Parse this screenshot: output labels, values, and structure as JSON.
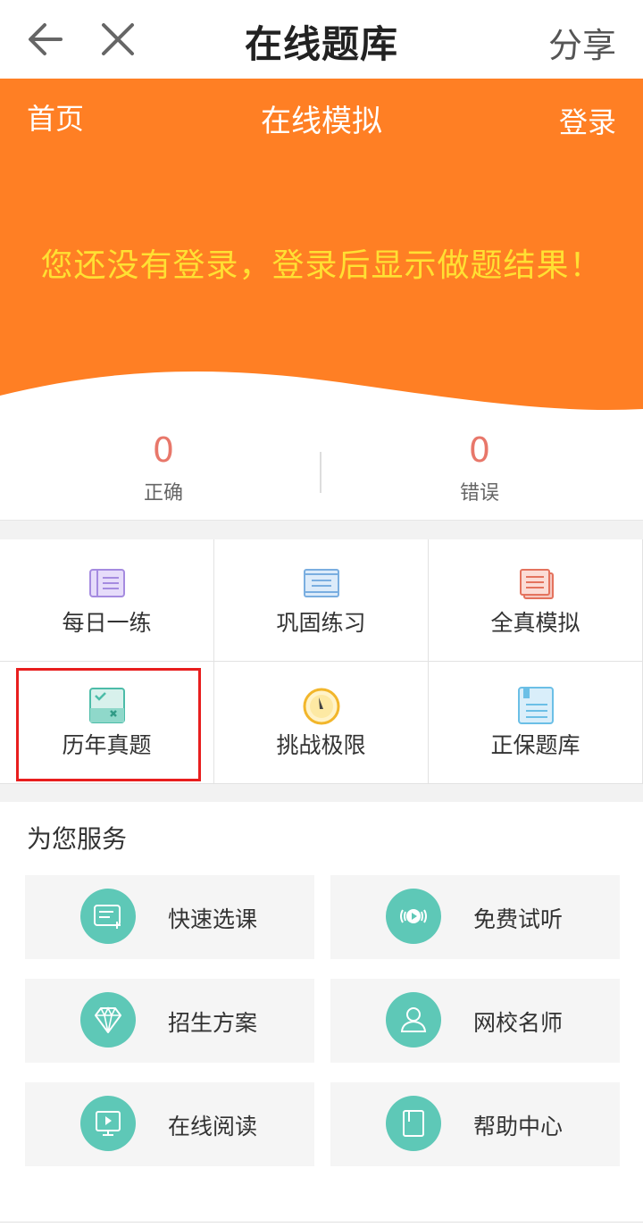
{
  "header": {
    "title": "在线题库",
    "share_label": "分享",
    "back_icon": "arrow-left-icon",
    "close_icon": "close-icon"
  },
  "banner": {
    "nav_home": "首页",
    "nav_title": "在线模拟",
    "nav_login": "登录",
    "message": "您还没有登录，登录后显示做题结果！",
    "bg_color": "#ff7f24",
    "message_color": "#ffe033"
  },
  "stats": {
    "correct_value": "0",
    "correct_label": "正确",
    "wrong_value": "0",
    "wrong_label": "错误"
  },
  "grid": {
    "items": [
      {
        "label": "每日一练",
        "icon": "notebook-icon"
      },
      {
        "label": "巩固练习",
        "icon": "document-icon"
      },
      {
        "label": "全真模拟",
        "icon": "stacked-papers-icon"
      },
      {
        "label": "历年真题",
        "icon": "check-x-paper-icon"
      },
      {
        "label": "挑战极限",
        "icon": "timer-icon"
      },
      {
        "label": "正保题库",
        "icon": "bookmark-book-icon"
      }
    ]
  },
  "services": {
    "title": "为您服务",
    "accent_color": "#5ec8b7",
    "items": [
      {
        "label": "快速选课",
        "icon": "course-list-icon"
      },
      {
        "label": "免费试听",
        "icon": "audio-play-icon"
      },
      {
        "label": "招生方案",
        "icon": "diamond-icon"
      },
      {
        "label": "网校名师",
        "icon": "user-icon"
      },
      {
        "label": "在线阅读",
        "icon": "monitor-play-icon"
      },
      {
        "label": "帮助中心",
        "icon": "book-icon"
      }
    ]
  }
}
